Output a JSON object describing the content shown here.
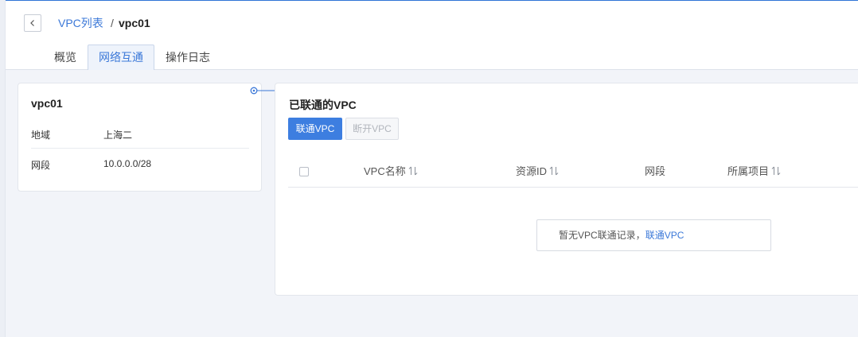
{
  "breadcrumb": {
    "parent_label": "VPC列表",
    "separator": "/",
    "current_label": "vpc01"
  },
  "tabs": [
    {
      "label": "概览",
      "active": false
    },
    {
      "label": "网络互通",
      "active": true
    },
    {
      "label": "操作日志",
      "active": false
    }
  ],
  "vpc_info": {
    "name": "vpc01",
    "rows": [
      {
        "key": "地域",
        "value": "上海二"
      },
      {
        "key": "网段",
        "value": "10.0.0.0/28"
      }
    ]
  },
  "connected_vpc": {
    "title": "已联通的VPC",
    "connect_button": "联通VPC",
    "disconnect_button": "断开VPC",
    "columns": [
      {
        "label": "VPC名称",
        "sortable": true
      },
      {
        "label": "资源ID",
        "sortable": true
      },
      {
        "label": "网段",
        "sortable": false
      },
      {
        "label": "所属项目",
        "sortable": true
      }
    ],
    "empty_text": "暂无VPC联通记录，",
    "empty_link": "联通VPC"
  },
  "colors": {
    "accent": "#3b78d8",
    "primary_button": "#3d7ee0",
    "top_border": "#2f74d6"
  },
  "icons": {
    "back": "chevron-left-icon",
    "sort": "sort-icon",
    "connector": "link-connector-icon"
  }
}
